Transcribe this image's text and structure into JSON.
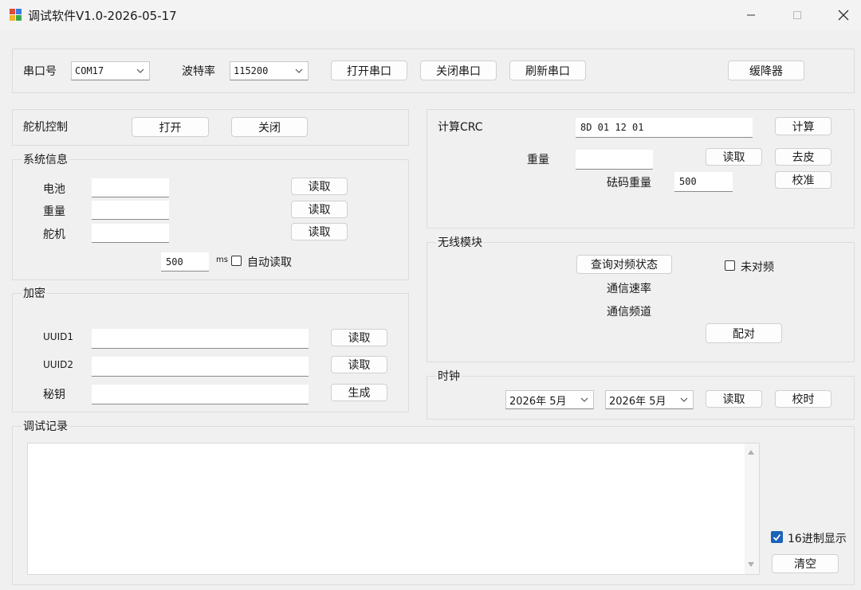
{
  "window": {
    "title": "调试软件V1.0-2026-05-17"
  },
  "serial": {
    "port_label": "串口号",
    "port_value": "COM17",
    "baud_label": "波特率",
    "baud_value": "115200",
    "open_label": "打开串口",
    "close_label": "关闭串口",
    "refresh_label": "刷新串口",
    "extra_label": "缓降器"
  },
  "servo": {
    "label": "舵机控制",
    "open_label": "打开",
    "close_label": "关闭"
  },
  "system_info": {
    "legend": "系统信息",
    "battery_label": "电池",
    "weight_label": "重量",
    "servo_label": "舵机",
    "read_label": "读取",
    "interval_value": "500",
    "interval_unit": "ms",
    "auto_read_label": "自动读取"
  },
  "encryption": {
    "legend": "加密",
    "uuid1_label": "UUID1",
    "uuid2_label": "UUID2",
    "key_label": "秘钥",
    "read_label": "读取",
    "generate_label": "生成"
  },
  "crc": {
    "label": "计算CRC",
    "input_value": "8D 01 12 01",
    "calc_label": "计算",
    "weight_label": "重量",
    "read_label": "读取",
    "tare_label": "去皮",
    "ref_weight_label": "砝码重量",
    "ref_weight_value": "500",
    "calibrate_label": "校准"
  },
  "wireless": {
    "legend": "无线模块",
    "query_label": "查询对频状态",
    "status_label": "未对频",
    "rate_label": "通信速率",
    "channel_label": "通信频道",
    "pair_label": "配对"
  },
  "clock": {
    "legend": "时钟",
    "date1": "2026年 5月",
    "date2": "2026年 5月",
    "read_label": "读取",
    "sync_label": "校时"
  },
  "log": {
    "legend": "调试记录",
    "hex_label": "16进制显示",
    "clear_label": "清空"
  },
  "colors": {
    "accent": "#1a63b8",
    "background": "#f0f0f0"
  }
}
